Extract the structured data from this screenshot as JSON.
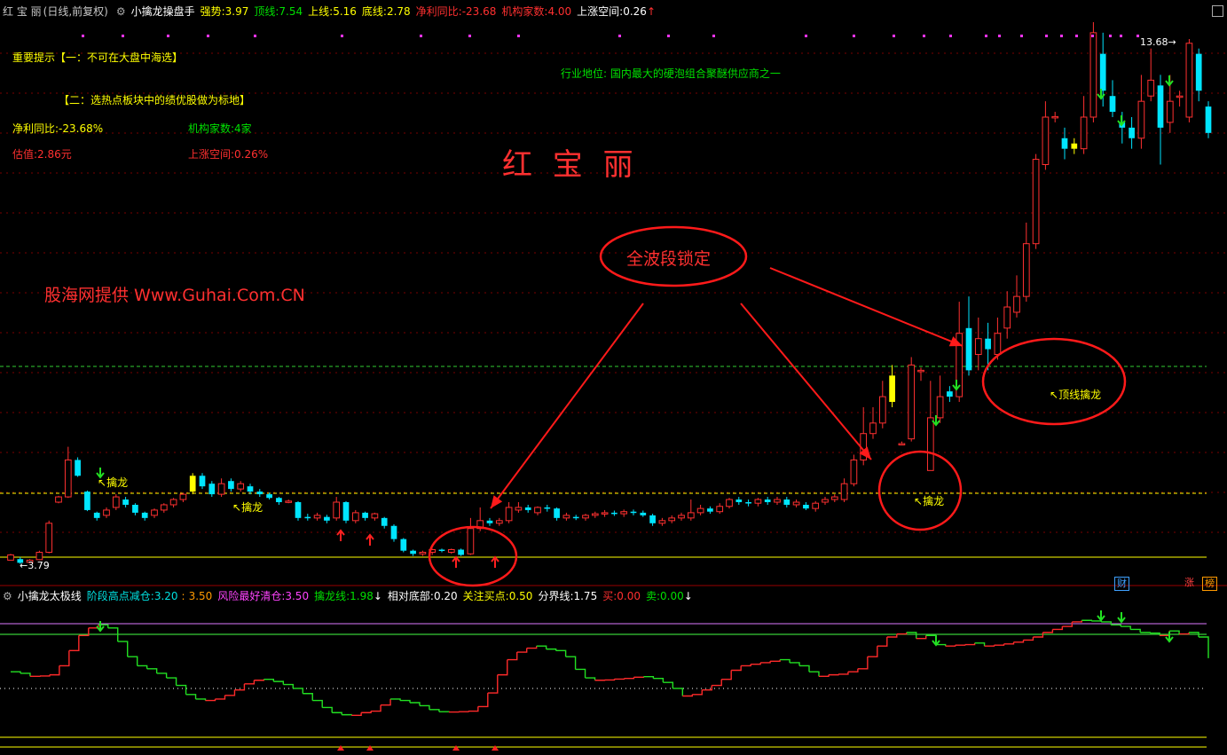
{
  "main_header": {
    "stock": "红 宝 丽",
    "period": "(日线,前复权)",
    "indicator": "小擒龙操盘手",
    "strength_label": "强势:",
    "strength_value": "3.97",
    "top_label": "顶线:",
    "top_value": "7.54",
    "upper_label": "上线:",
    "upper_value": "5.16",
    "bottom_label": "底线:",
    "bottom_value": "2.78",
    "profit_label": "净利同比:",
    "profit_value": "-23.68",
    "inst_label": "机构家数:",
    "inst_value": "4.00",
    "space_label": "上涨空间:",
    "space_value": "0.26",
    "space_arrow": "↑"
  },
  "annotations": {
    "tip_title": "重要提示【一：不可在大盘中海选】",
    "tip_two": "【二：选热点板块中的绩优股做为标地】",
    "profit": "净利同比:-23.68%",
    "institutions": "机构家数:4家",
    "valuation": "估值:2.86元",
    "space": "上涨空间:0.26%",
    "industry": "行业地位: 国内最大的硬泡组合聚醚供应商之一",
    "stock_big": "红 宝 丽",
    "watermark": "股海网提供 Www.Guhai.Com.CN",
    "ellipse_label": "全波段锁定",
    "qinlong1": "擒龙",
    "qinlong2": "擒龙",
    "qinlong3": "擒龙",
    "top_qinlong": "顶线擒龙",
    "max_label": "13.68",
    "min_label": "3.79"
  },
  "sub_header": {
    "indicator": "小擒龙太极线",
    "stage_label": "阶段高点减仓:",
    "stage_v1": "3.20",
    "stage_v2": "3.50",
    "risk_label": "风险最好清仓:",
    "risk_value": "3.50",
    "qlx_label": "擒龙线:",
    "qlx_value": "1.98",
    "rel_label": "相对底部:",
    "rel_value": "0.20",
    "focus_label": "关注买点:",
    "focus_value": "0.50",
    "split_label": "分界线:",
    "split_value": "1.75",
    "buy_label": "买:",
    "buy_value": "0.00",
    "sell_label": "卖:",
    "sell_value": "0.00"
  },
  "badges": {
    "fin": "财",
    "up": "涨",
    "hot": "榜"
  },
  "colors": {
    "up": "#ff3030",
    "down": "#00e5ff",
    "yellow_candle": "#ffff00",
    "grid": "#7a0000"
  },
  "chart_data": [
    {
      "type": "candlestick",
      "title": "红 宝 丽",
      "reference_lines": [
        {
          "name": "顶线",
          "value": 7.54
        },
        {
          "name": "上线",
          "value": 5.16
        },
        {
          "name": "底线",
          "value": 2.78
        }
      ],
      "ylim": [
        3.3,
        14.1
      ],
      "candles": [
        [
          3.8,
          3.9,
          3.82,
          3.92
        ],
        [
          3.82,
          3.75,
          3.86,
          3.73
        ],
        [
          3.76,
          3.8,
          3.82,
          3.74
        ],
        [
          3.81,
          3.95,
          3.98,
          3.8
        ],
        [
          3.95,
          4.5,
          4.55,
          3.93
        ],
        [
          4.9,
          5.0,
          5.02,
          4.88
        ],
        [
          5.0,
          5.7,
          5.95,
          4.98
        ],
        [
          5.7,
          5.4,
          5.75,
          5.38
        ],
        [
          5.1,
          4.75,
          5.12,
          4.73
        ],
        [
          4.7,
          4.6,
          4.72,
          4.55
        ],
        [
          4.65,
          4.75,
          4.8,
          4.6
        ],
        [
          4.8,
          5.0,
          5.05,
          4.75
        ],
        [
          4.95,
          4.85,
          5.0,
          4.8
        ],
        [
          4.85,
          4.7,
          4.88,
          4.65
        ],
        [
          4.7,
          4.6,
          4.72,
          4.55
        ],
        [
          4.65,
          4.75,
          4.78,
          4.6
        ],
        [
          4.75,
          4.85,
          4.88,
          4.7
        ],
        [
          4.85,
          4.95,
          4.98,
          4.8
        ],
        [
          4.95,
          5.05,
          5.08,
          4.9
        ],
        [
          5.1,
          5.4,
          5.45,
          5.05
        ],
        [
          5.4,
          5.2,
          5.45,
          5.15
        ],
        [
          5.25,
          5.05,
          5.3,
          5.0
        ],
        [
          5.05,
          5.25,
          5.35,
          5.0
        ],
        [
          5.3,
          5.15,
          5.35,
          5.1
        ],
        [
          5.15,
          5.25,
          5.3,
          5.1
        ],
        [
          5.2,
          5.1,
          5.25,
          5.05
        ],
        [
          5.1,
          5.05,
          5.15,
          5.0
        ],
        [
          5.05,
          4.98,
          5.08,
          4.95
        ],
        [
          4.98,
          4.9,
          5.0,
          4.85
        ],
        [
          4.9,
          4.92,
          4.95,
          4.88
        ],
        [
          4.9,
          4.6,
          4.92,
          4.55
        ],
        [
          4.62,
          4.6,
          4.68,
          4.55
        ],
        [
          4.6,
          4.65,
          4.7,
          4.55
        ],
        [
          4.62,
          4.55,
          4.66,
          4.5
        ],
        [
          4.6,
          4.9,
          5.0,
          4.55
        ],
        [
          4.9,
          4.55,
          4.92,
          4.5
        ],
        [
          4.55,
          4.7,
          4.75,
          4.5
        ],
        [
          4.7,
          4.6,
          4.72,
          4.55
        ],
        [
          4.6,
          4.68,
          4.7,
          4.55
        ],
        [
          4.6,
          4.45,
          4.62,
          4.4
        ],
        [
          4.45,
          4.2,
          4.48,
          4.15
        ],
        [
          4.2,
          3.98,
          4.22,
          3.95
        ],
        [
          3.98,
          3.92,
          4.0,
          3.88
        ],
        [
          3.92,
          3.95,
          3.98,
          3.88
        ],
        [
          3.95,
          4.0,
          4.02,
          3.9
        ],
        [
          4.0,
          3.98,
          4.02,
          3.95
        ],
        [
          3.95,
          4.0,
          4.02,
          3.92
        ],
        [
          4.0,
          3.9,
          4.02,
          3.88
        ],
        [
          3.92,
          4.4,
          4.6,
          3.9
        ],
        [
          4.4,
          4.55,
          4.8,
          4.35
        ],
        [
          4.55,
          4.5,
          4.6,
          4.45
        ],
        [
          4.5,
          4.55,
          4.6,
          4.45
        ],
        [
          4.55,
          4.8,
          4.9,
          4.5
        ],
        [
          4.75,
          4.8,
          4.9,
          4.7
        ],
        [
          4.8,
          4.75,
          4.85,
          4.7
        ],
        [
          4.7,
          4.8,
          4.82,
          4.65
        ],
        [
          4.8,
          4.78,
          4.85,
          4.72
        ],
        [
          4.78,
          4.6,
          4.8,
          4.55
        ],
        [
          4.6,
          4.65,
          4.7,
          4.55
        ],
        [
          4.62,
          4.6,
          4.66,
          4.56
        ],
        [
          4.6,
          4.65,
          4.68,
          4.55
        ],
        [
          4.65,
          4.68,
          4.72,
          4.6
        ],
        [
          4.68,
          4.7,
          4.75,
          4.62
        ],
        [
          4.7,
          4.68,
          4.74,
          4.64
        ],
        [
          4.68,
          4.72,
          4.76,
          4.62
        ],
        [
          4.72,
          4.7,
          4.76,
          4.65
        ],
        [
          4.7,
          4.65,
          4.74,
          4.62
        ],
        [
          4.65,
          4.5,
          4.68,
          4.45
        ],
        [
          4.5,
          4.55,
          4.6,
          4.45
        ],
        [
          4.55,
          4.6,
          4.65,
          4.5
        ],
        [
          4.6,
          4.65,
          4.7,
          4.55
        ],
        [
          4.6,
          4.7,
          4.95,
          4.55
        ],
        [
          4.7,
          4.78,
          4.85,
          4.65
        ],
        [
          4.78,
          4.72,
          4.82,
          4.68
        ],
        [
          4.72,
          4.82,
          4.88,
          4.68
        ],
        [
          4.82,
          4.95,
          4.98,
          4.78
        ],
        [
          4.95,
          4.9,
          5.0,
          4.85
        ],
        [
          4.9,
          4.88,
          4.95,
          4.82
        ],
        [
          4.88,
          4.95,
          4.98,
          4.82
        ],
        [
          4.95,
          4.9,
          5.0,
          4.85
        ],
        [
          4.9,
          4.95,
          5.0,
          4.85
        ],
        [
          4.95,
          4.85,
          5.0,
          4.8
        ],
        [
          4.85,
          4.9,
          4.95,
          4.8
        ],
        [
          4.85,
          4.78,
          4.9,
          4.75
        ],
        [
          4.78,
          4.88,
          4.92,
          4.72
        ],
        [
          4.9,
          4.95,
          5.0,
          4.85
        ],
        [
          4.95,
          5.0,
          5.05,
          4.9
        ],
        [
          4.95,
          5.25,
          5.35,
          4.9
        ],
        [
          5.25,
          5.7,
          5.8,
          5.2
        ],
        [
          5.7,
          6.2,
          6.7,
          5.6
        ],
        [
          6.2,
          6.4,
          6.7,
          6.1
        ],
        [
          6.4,
          6.9,
          7.2,
          6.3
        ],
        [
          6.8,
          7.3,
          7.5,
          6.7
        ],
        [
          6.0,
          6.01,
          6.05,
          5.98
        ],
        [
          6.1,
          7.5,
          7.65,
          6.05
        ],
        [
          7.4,
          7.4,
          7.45,
          7.2
        ],
        [
          5.5,
          6.5,
          7.2,
          5.5
        ],
        [
          6.5,
          6.9,
          7.3,
          6.4
        ],
        [
          7.0,
          6.9,
          7.1,
          6.8
        ],
        [
          6.9,
          8.1,
          8.7,
          6.8
        ],
        [
          8.2,
          7.4,
          8.8,
          7.3
        ],
        [
          7.7,
          8.0,
          8.4,
          7.4
        ],
        [
          8.0,
          7.8,
          8.3,
          7.4
        ],
        [
          7.7,
          8.1,
          8.4,
          7.6
        ],
        [
          8.2,
          8.6,
          8.9,
          8.0
        ],
        [
          8.5,
          8.8,
          9.2,
          8.4
        ],
        [
          8.8,
          9.8,
          10.2,
          8.7
        ],
        [
          9.8,
          11.4,
          11.5,
          9.7
        ],
        [
          11.3,
          12.2,
          12.5,
          11.2
        ],
        [
          12.2,
          12.21,
          12.3,
          12.1
        ],
        [
          11.8,
          11.6,
          12.0,
          11.4
        ],
        [
          11.6,
          11.7,
          11.8,
          11.5
        ],
        [
          11.6,
          12.2,
          12.6,
          11.5
        ],
        [
          12.2,
          13.8,
          14.0,
          12.1
        ],
        [
          13.4,
          12.7,
          13.8,
          12.4
        ],
        [
          12.6,
          12.3,
          12.9,
          12.2
        ],
        [
          12.1,
          12.0,
          12.3,
          11.7
        ],
        [
          12.0,
          11.8,
          12.2,
          11.6
        ],
        [
          11.8,
          12.5,
          13.0,
          11.6
        ],
        [
          12.6,
          12.9,
          13.5,
          12.5
        ],
        [
          12.8,
          12.0,
          13.0,
          11.3
        ],
        [
          12.1,
          12.5,
          13.0,
          11.9
        ],
        [
          12.6,
          12.6,
          12.7,
          12.4
        ],
        [
          12.2,
          13.6,
          13.68,
          12.1
        ],
        [
          13.4,
          12.7,
          13.5,
          12.5
        ],
        [
          12.4,
          11.9,
          12.5,
          11.8
        ]
      ]
    },
    {
      "type": "line",
      "title": "小擒龙太极线",
      "reference_lines": [
        {
          "name": "阶段高点减仓",
          "value": 3.5
        },
        {
          "name": "风险最好清仓",
          "value": 3.2
        },
        {
          "name": "分界线",
          "value": 1.75
        },
        {
          "name": "关注买点",
          "value": 0.5
        },
        {
          "name": "相对底部",
          "value": 0.2
        }
      ],
      "ylim": [
        0,
        3.9
      ],
      "values": [
        1.9,
        1.85,
        1.75,
        1.76,
        1.8,
        2.1,
        2.6,
        3.1,
        3.35,
        3.45,
        3.35,
        2.9,
        2.4,
        2.1,
        2.0,
        1.85,
        1.7,
        1.45,
        1.15,
        1.0,
        0.95,
        1.0,
        1.12,
        1.3,
        1.5,
        1.62,
        1.65,
        1.58,
        1.48,
        1.35,
        1.18,
        0.95,
        0.72,
        0.55,
        0.48,
        0.46,
        0.55,
        0.6,
        0.8,
        1.0,
        0.95,
        0.88,
        0.78,
        0.65,
        0.58,
        0.57,
        0.58,
        0.6,
        0.75,
        1.2,
        1.8,
        2.3,
        2.55,
        2.68,
        2.75,
        2.65,
        2.6,
        2.4,
        1.98,
        1.7,
        1.62,
        1.63,
        1.66,
        1.68,
        1.72,
        1.74,
        1.68,
        1.55,
        1.35,
        1.1,
        1.15,
        1.3,
        1.45,
        1.65,
        1.95,
        2.1,
        2.15,
        2.2,
        2.25,
        2.3,
        2.2,
        2.1,
        1.9,
        1.75,
        1.8,
        1.82,
        1.9,
        2.0,
        2.4,
        2.75,
        3.05,
        3.15,
        3.2,
        3.0,
        3.1,
        2.8,
        2.75,
        2.78,
        2.8,
        2.85,
        2.75,
        2.78,
        2.82,
        2.88,
        2.95,
        3.05,
        3.2,
        3.3,
        3.4,
        3.55,
        3.6,
        3.58,
        3.55,
        3.45,
        3.4,
        3.3,
        3.2,
        3.18,
        3.1,
        3.25,
        3.15,
        3.2,
        3.05,
        2.35
      ]
    }
  ]
}
